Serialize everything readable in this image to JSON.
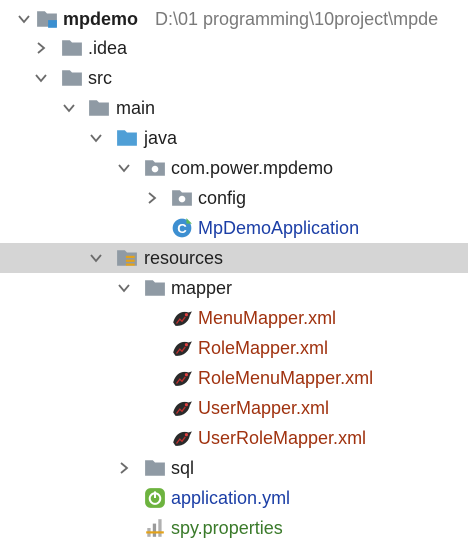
{
  "project": {
    "name": "mpdemo",
    "path": "D:\\01 programming\\10project\\mpde"
  },
  "items": {
    "idea": ".idea",
    "src": "src",
    "main": "main",
    "java": "java",
    "package": "com.power.mpdemo",
    "config": "config",
    "app_class": "MpDemoApplication",
    "resources": "resources",
    "mapper": "mapper",
    "xml_files": [
      "MenuMapper.xml",
      "RoleMapper.xml",
      "RoleMenuMapper.xml",
      "UserMapper.xml",
      "UserRoleMapper.xml"
    ],
    "sql": "sql",
    "yml": "application.yml",
    "properties": "spy.properties"
  },
  "icons": {
    "folder": "folder-icon",
    "source_folder": "source-folder-icon",
    "package": "package-icon",
    "class": "spring-class-icon",
    "resources": "resources-folder-icon",
    "mybatis": "mybatis-bird-icon",
    "spring_boot": "spring-boot-icon",
    "properties": "properties-file-icon"
  },
  "colors": {
    "selection": "#d5d5d5",
    "java_class": "#1b3ea6",
    "xml_file": "#a0320f",
    "properties_file": "#3a7a2a",
    "folder": "#8f9aa4",
    "source_folder": "#4f9fd6"
  }
}
